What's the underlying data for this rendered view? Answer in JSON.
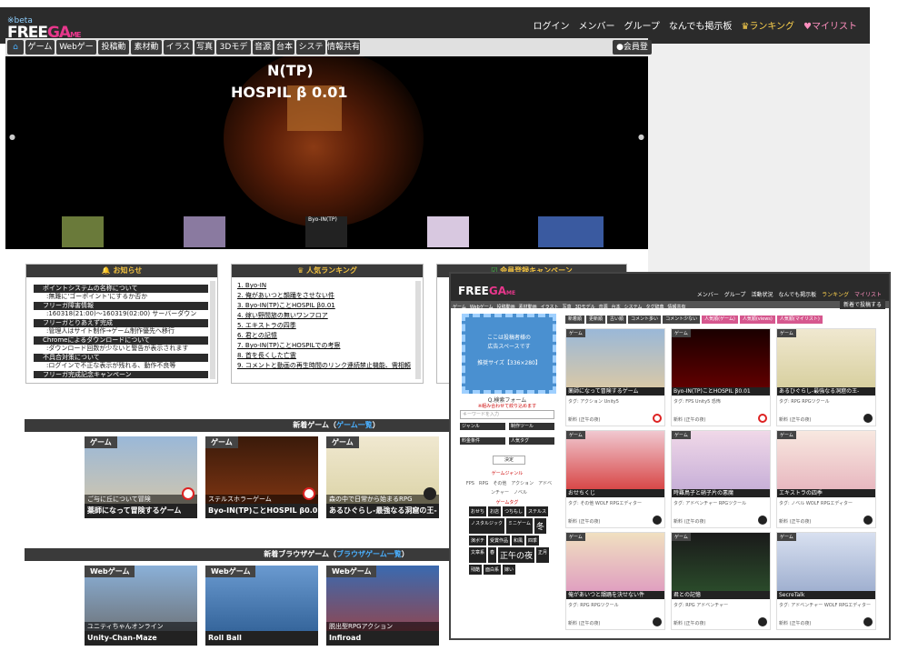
{
  "header": {
    "beta": "※beta",
    "logo_a": "FREE",
    "logo_b": "GA",
    "logo_c": "ME",
    "nav": [
      "ログイン",
      "メンバー",
      "グループ",
      "なんでも掲示板"
    ],
    "nav_rank": "ランキング",
    "nav_fav": "マイリスト"
  },
  "categories": [
    "ゲーム",
    "Webゲーム",
    "投稿動画",
    "素材動画",
    "イラスト",
    "写真",
    "3Dモデル",
    "音源",
    "台本",
    "システム",
    "情報共有"
  ],
  "signup": "会員登録",
  "slider": {
    "title1": "N(TP)",
    "title2": "HOSPIL β 0.01",
    "thumb_label": "Byo-IN(TP)"
  },
  "news": {
    "title": "お知らせ",
    "items": [
      {
        "t": "ポイントシステムの名称について",
        "s": ":無難に'ゴーポイント'にするか否か"
      },
      {
        "t": "フリーガ障害情報",
        "s": ":160318(21:00)〜160319(02:00) サーバーダウン"
      },
      {
        "t": "フリーガとりあえず完成",
        "s": ":管理人はサイト制作→ゲーム制作優先へ移行"
      },
      {
        "t": "Chromeによるダウンロードについて",
        "s": ":ダウンロード回数が少ないと警告が表示されます"
      },
      {
        "t": "不具合対策について",
        "s": ":ログインで不正な表示が残れる、動作不良等"
      },
      {
        "t": "フリーガ完成記念キャンペーン",
        "s": ""
      }
    ]
  },
  "ranking": {
    "title": "人気ランキング",
    "items": [
      "1. Byo-IN",
      "2. 俺があいつと韻踊をさせない件",
      "3. Byo-IN(TP)ことHOSPIL β0.01",
      "4. 嫁い野間旅の無いワンフロア",
      "5. エキストラの四季",
      "6. 君との記憶",
      "7. Byo-IN(TP)ことHOSPILでの考察",
      "8. 首を長くした亡霊",
      "9. コメントと動画の再生時間のリンク連続禁止機能、需相頼"
    ]
  },
  "campaign": {
    "title": "会員登録キャンペーン"
  },
  "new_games": {
    "title": "新着ゲーム（",
    "link": "ゲーム一覧",
    "tail": "）",
    "cards": [
      {
        "tag": "ゲーム",
        "cap": "ご与に丘について冒険",
        "name": "薬師になって冒険するゲーム"
      },
      {
        "tag": "ゲーム",
        "cap": "ステルスホラーゲーム",
        "name": "Byo-IN(TP)ことHOSPIL β0.01"
      },
      {
        "tag": "ゲーム",
        "cap": "森の中で日常から始まるRPG",
        "name": "あるひぐらし-最強なる洞窟の王-"
      }
    ]
  },
  "new_browser": {
    "title": "新着ブラウザゲーム（",
    "link": "ブラウザゲーム一覧",
    "tail": "）",
    "cards": [
      {
        "tag": "Webゲーム",
        "cap": "ユニティちゃんオンライン",
        "name": "Unity-Chan-Maze"
      },
      {
        "tag": "Webゲーム",
        "cap": "",
        "name": "Roll Ball"
      },
      {
        "tag": "Webゲーム",
        "cap": "脱出型RPGアクション",
        "name": "Infiroad"
      }
    ]
  },
  "inset": {
    "logo_a": "FREE",
    "logo_b": "GA",
    "logo_c": "ME",
    "nav": [
      "メンバー",
      "グループ",
      "活動状況",
      "なんでも掲示板"
    ],
    "nav_rank": "ランキング",
    "nav_fav": "マイリスト",
    "menu": [
      "ゲーム",
      "Webゲーム",
      "投稿動画",
      "素材動画",
      "イラスト",
      "写真",
      "3Dモデル",
      "音源",
      "台本",
      "システム",
      "タグ辞典",
      "情報共有"
    ],
    "post": "新着で投稿する",
    "ad": [
      "ここは投稿者様の",
      "広告スペースです",
      "推奨サイズ【336×280】"
    ],
    "search_title": "Q.検索フォーム",
    "search_warn": "※組み合わせて絞り込めます",
    "search_ph": "キーワードを入力",
    "selects": [
      "ジャンル",
      "制作ツール",
      "料金条件",
      "人気タグ"
    ],
    "decide": "決定",
    "genre_title": "ゲームジャンル",
    "genres": "FPS　RPG　その他　アクション　アドベンチャー　ノベル",
    "tag_title": "ゲームタグ",
    "tags": [
      "おせち",
      "お店",
      "つちもし",
      "ステルス",
      "ノスタルジック",
      "ミニゲーム",
      "冬",
      "演ボチ",
      "受賞作品",
      "和風",
      "四季",
      "文章系",
      "春",
      "正午の夜",
      "正月",
      "残酷",
      "面白系",
      "嫁い"
    ],
    "filters": [
      "新着順",
      "更新順",
      "古い順",
      "コメント多い",
      "コメント少ない",
      "人気順(ゲーム)",
      "人気順(views)",
      "人気順(マイリスト)"
    ],
    "cards": [
      {
        "tag": "ゲーム",
        "nm": "薬師になって冒険するゲーム",
        "ds": "タグ: アクション Unity5",
        "dl": "新料 (正午の夜)"
      },
      {
        "tag": "ゲーム",
        "nm": "Byo-IN(TP)ことHOSPIL β0.01",
        "ds": "タグ: FPS Unity5 恐怖",
        "dl": "新料 (正午の夜)"
      },
      {
        "tag": "ゲーム",
        "nm": "あるひぐらし-最強なる洞窟の王-",
        "ds": "タグ: RPG RPGツクール",
        "dl": "新料 (正午の夜)"
      },
      {
        "tag": "ゲーム",
        "nm": "おせちくじ",
        "ds": "タグ: その他 WOLF RPGエディター",
        "dl": "新料 (正午の夜)"
      },
      {
        "tag": "ゲーム",
        "nm": "時難鳥子と硝子片の悪魔",
        "ds": "タグ: アドベンチャー RPGツクール",
        "dl": "新料 (正午の夜)"
      },
      {
        "tag": "ゲーム",
        "nm": "エキストラの四季",
        "ds": "タグ: ノベル WOLF RPGエディター",
        "dl": "新料 (正午の夜)"
      },
      {
        "tag": "ゲーム",
        "nm": "俺があいつと韻踊を決せない件",
        "ds": "タグ: RPG RPGツクール",
        "dl": "新料 (正午の夜)"
      },
      {
        "tag": "ゲーム",
        "nm": "君との記憶",
        "ds": "タグ: RPG アドベンチャー",
        "dl": "新料 (正午の夜)"
      },
      {
        "tag": "ゲーム",
        "nm": "SecreTalk",
        "ds": "タグ: アドベンチャー WOLF RPGエディター",
        "dl": "新料 (正午の夜)"
      }
    ]
  }
}
